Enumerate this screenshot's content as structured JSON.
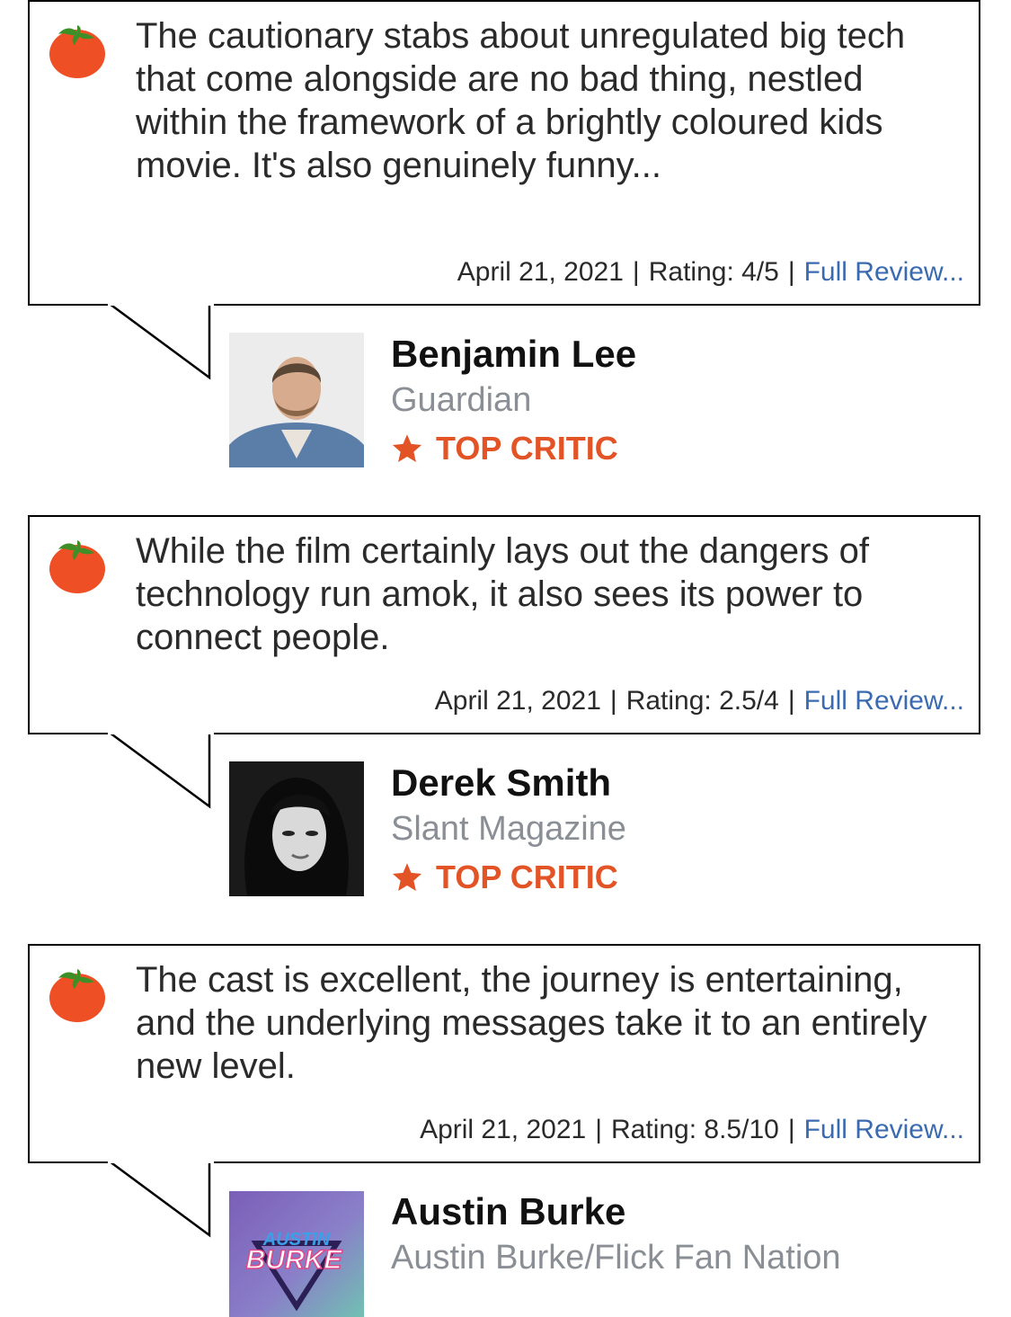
{
  "colors": {
    "accent_orange": "#e25426",
    "link_blue": "#3a6bb0",
    "publication_gray": "#8a8f96",
    "tomato_red": "#ef4f24",
    "tomato_green": "#3f8f29"
  },
  "reviews": [
    {
      "icon": "fresh-tomato-icon",
      "quote": "The cautionary stabs about unregulated big tech that come alongside are no bad thing, nestled within the framework of a brightly coloured kids movie. It's also genuinely funny...",
      "date": "April 21, 2021",
      "separator": "|",
      "rating": "Rating: 4/5",
      "full_review": "Full Review...",
      "critic_name": "Benjamin Lee",
      "publication": "Guardian",
      "badge": "TOP CRITIC"
    },
    {
      "icon": "fresh-tomato-icon",
      "quote": "While the film certainly lays out the dangers of technology run amok, it also sees its power to connect people.",
      "date": "April 21, 2021",
      "separator": "|",
      "rating": "Rating: 2.5/4",
      "full_review": "Full Review...",
      "critic_name": "Derek Smith",
      "publication": "Slant Magazine",
      "badge": "TOP CRITIC"
    },
    {
      "icon": "fresh-tomato-icon",
      "quote": "The cast is excellent, the journey is entertaining, and the underlying messages take it to an entirely new level.",
      "date": "April 21, 2021",
      "separator": "|",
      "rating": "Rating: 8.5/10",
      "full_review": "Full Review...",
      "critic_name": "Austin Burke",
      "publication": "Austin Burke/Flick Fan Nation",
      "avatar_text_top": "AUSTIN",
      "avatar_text_bottom": "BURKE"
    }
  ]
}
